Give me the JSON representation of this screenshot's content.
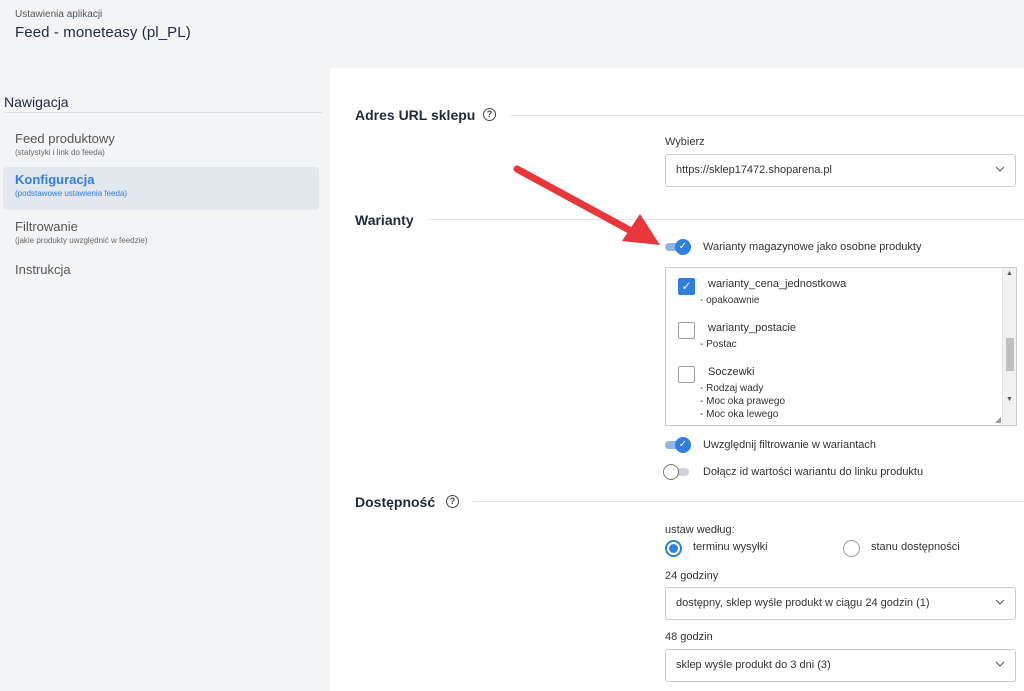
{
  "header": {
    "subtitle": "Ustawienia aplikacji",
    "title": "Feed - moneteasy (pl_PL)"
  },
  "sidebar": {
    "title": "Nawigacja",
    "items": [
      {
        "label": "Feed produktowy",
        "desc": "(statystyki i link do feeda)"
      },
      {
        "label": "Konfiguracja",
        "desc": "(podstawowe ustawienia feeda)"
      },
      {
        "label": "Filtrowanie",
        "desc": "(jakie produkty uwzględnić w feedzie)"
      },
      {
        "label": "Instrukcja",
        "desc": ""
      }
    ]
  },
  "url_section": {
    "title": "Adres URL sklepu",
    "help": "?",
    "select_label": "Wybierz",
    "select_value": "https://sklep17472.shoparena.pl"
  },
  "variants": {
    "title": "Warianty",
    "toggle_stock": "Warianty magazynowe jako osobne produkty",
    "list": [
      {
        "name": "warianty_cena_jednostkowa",
        "checked": true,
        "subs": [
          "- opakoawnie"
        ]
      },
      {
        "name": "warianty_postacie",
        "checked": false,
        "subs": [
          "- Postac"
        ]
      },
      {
        "name": "Soczewki",
        "checked": false,
        "subs": [
          "- Rodzaj wady",
          "- Moc oka prawego",
          "- Moc oka lewego"
        ]
      }
    ],
    "toggle_filter": "Uwzględnij filtrowanie w wariantach",
    "toggle_link": "Dołącz id wartości wariantu do linku produktu"
  },
  "availability": {
    "title": "Dostępność",
    "help": "?",
    "set_by_label": "ustaw według:",
    "radio_shipping": "terminu wysyłki",
    "radio_stock": "stanu dostępności",
    "h24_label": "24 godziny",
    "h24_value": "dostępny, sklep wyśle produkt w ciągu 24 godzin (1)",
    "h48_label": "48 godzin",
    "h48_value": "sklep wyśle produkt do 3 dni (3)"
  },
  "colors": {
    "accent": "#2f7ee0",
    "annotation_arrow": "#e8363a"
  }
}
